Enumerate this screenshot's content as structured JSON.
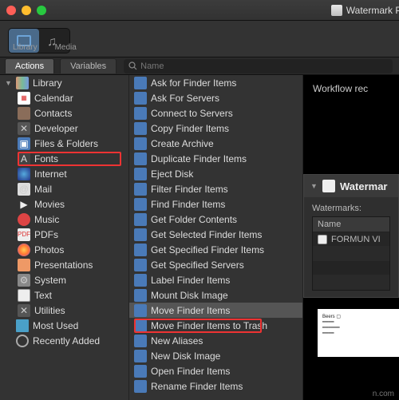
{
  "title": "Watermark PD",
  "toolbar": {
    "library_label": "Library",
    "media_label": "Media"
  },
  "tabs": {
    "actions": "Actions",
    "variables": "Variables"
  },
  "search": {
    "placeholder": "Name"
  },
  "library": {
    "root": "Library",
    "items": [
      {
        "label": "Calendar",
        "icon": "ic-cal"
      },
      {
        "label": "Contacts",
        "icon": "ic-contacts"
      },
      {
        "label": "Developer",
        "icon": "ic-dev"
      },
      {
        "label": "Files & Folders",
        "icon": "ic-ff"
      },
      {
        "label": "Fonts",
        "icon": "ic-font"
      },
      {
        "label": "Internet",
        "icon": "ic-net"
      },
      {
        "label": "Mail",
        "icon": "ic-mail"
      },
      {
        "label": "Movies",
        "icon": "ic-mov"
      },
      {
        "label": "Music",
        "icon": "ic-music"
      },
      {
        "label": "PDFs",
        "icon": "ic-pdf"
      },
      {
        "label": "Photos",
        "icon": "ic-photo"
      },
      {
        "label": "Presentations",
        "icon": "ic-pres"
      },
      {
        "label": "System",
        "icon": "ic-sys"
      },
      {
        "label": "Text",
        "icon": "ic-txt"
      },
      {
        "label": "Utilities",
        "icon": "ic-util"
      }
    ],
    "most_used": "Most Used",
    "recently_added": "Recently Added"
  },
  "actions": [
    "Ask for Finder Items",
    "Ask For Servers",
    "Connect to Servers",
    "Copy Finder Items",
    "Create Archive",
    "Duplicate Finder Items",
    "Eject Disk",
    "Filter Finder Items",
    "Find Finder Items",
    "Get Folder Contents",
    "Get Selected Finder Items",
    "Get Specified Finder Items",
    "Get Specified Servers",
    "Label Finder Items",
    "Mount Disk Image",
    "Move Finder Items",
    "Move Finder Items to Trash",
    "New Aliases",
    "New Disk Image",
    "Open Finder Items",
    "Rename Finder Items"
  ],
  "workflow": {
    "header": "Workflow rec"
  },
  "watermark_panel": {
    "title": "Watermar",
    "label": "Watermarks:",
    "col": "Name",
    "row": "FORMUN VI"
  },
  "footer_url": "n.com"
}
